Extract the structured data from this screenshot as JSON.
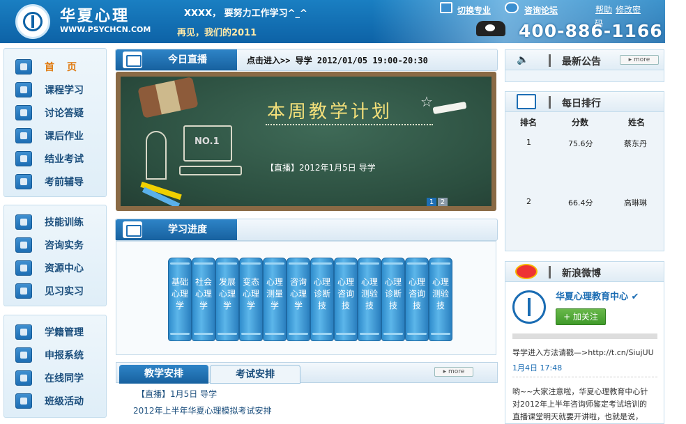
{
  "header": {
    "site_title": "华夏心理",
    "site_url": "WWW.PSYCHCN.COM",
    "greeting": "XXXX， 要努力工作学习^_^",
    "slogan": "再见，我们的2011",
    "switch_major": "切换专业",
    "forum": "咨询论坛",
    "help": "帮助",
    "change_password": "修改密",
    "change_password_wrap": "码",
    "hotline": "400-886-1166",
    "colors": {
      "header_blue": "#1a7fc2",
      "accent_orange": "#e07a10"
    }
  },
  "sidebar": {
    "group1": [
      {
        "label": "首页",
        "icon": "home-icon",
        "active": true
      },
      {
        "label": "课程学习",
        "icon": "course-icon"
      },
      {
        "label": "讨论答疑",
        "icon": "discussion-icon"
      },
      {
        "label": "课后作业",
        "icon": "homework-icon"
      },
      {
        "label": "结业考试",
        "icon": "exam-icon"
      },
      {
        "label": "考前辅导",
        "icon": "tutoring-icon"
      }
    ],
    "group2": [
      {
        "label": "技能训练",
        "icon": "tools-icon"
      },
      {
        "label": "咨询实务",
        "icon": "practice-icon"
      },
      {
        "label": "资源中心",
        "icon": "resource-icon"
      },
      {
        "label": "见习实习",
        "icon": "briefcase-icon"
      }
    ],
    "group3": [
      {
        "label": "学籍管理",
        "icon": "records-icon"
      },
      {
        "label": "申报系统",
        "icon": "application-icon"
      },
      {
        "label": "在线同学",
        "icon": "classmates-icon"
      },
      {
        "label": "班级活动",
        "icon": "activity-icon"
      }
    ]
  },
  "live": {
    "title": "今日直播",
    "schedule": "点击进入>> 导学 2012/01/05 19:00-20:30",
    "board_title": "本周教学计划",
    "board_item": "【直播】2012年1月5日 导学",
    "sketch_label": "NO.1",
    "pages": [
      "1",
      "2"
    ]
  },
  "progress": {
    "title": "学习进度",
    "books": [
      "基础心理学",
      "社会心理学",
      "发展心理学",
      "变态心理学",
      "心理测量学",
      "咨询心理学",
      "心理诊断技",
      "心理咨询技",
      "心理测验技",
      "心理诊断技",
      "心理咨询技",
      "心理测验技"
    ]
  },
  "schedule": {
    "tab1": "教学安排",
    "tab2": "考试安排",
    "more": "▸ more",
    "items": [
      "【直播】1月5日 导学",
      "2012年上半年华夏心理模拟考试安排"
    ]
  },
  "notices": {
    "title": "最新公告",
    "more": "▸ more"
  },
  "ranking": {
    "title": "每日排行",
    "columns": [
      "排名",
      "分数",
      "姓名"
    ],
    "rows": [
      {
        "rank": "1",
        "score": "75.6分",
        "name": "蔡东丹"
      },
      {
        "rank": "2",
        "score": "66.4分",
        "name": "高琳琳"
      }
    ]
  },
  "weibo": {
    "title": "新浪微博",
    "account": "华夏心理教育中心",
    "follow": "+ 加关注",
    "post1": "导学进入方法请戳—>http://t.cn/SiujUU",
    "post1_time": "1月4日 17:48",
    "post2_line1": "哟~~大家注意啦，华夏心理教育中心针",
    "post2_line2": "对2012年上半年咨询师鉴定考试培训的",
    "post2_line3": "直播课堂明天就要开讲啦，也就是说，"
  }
}
